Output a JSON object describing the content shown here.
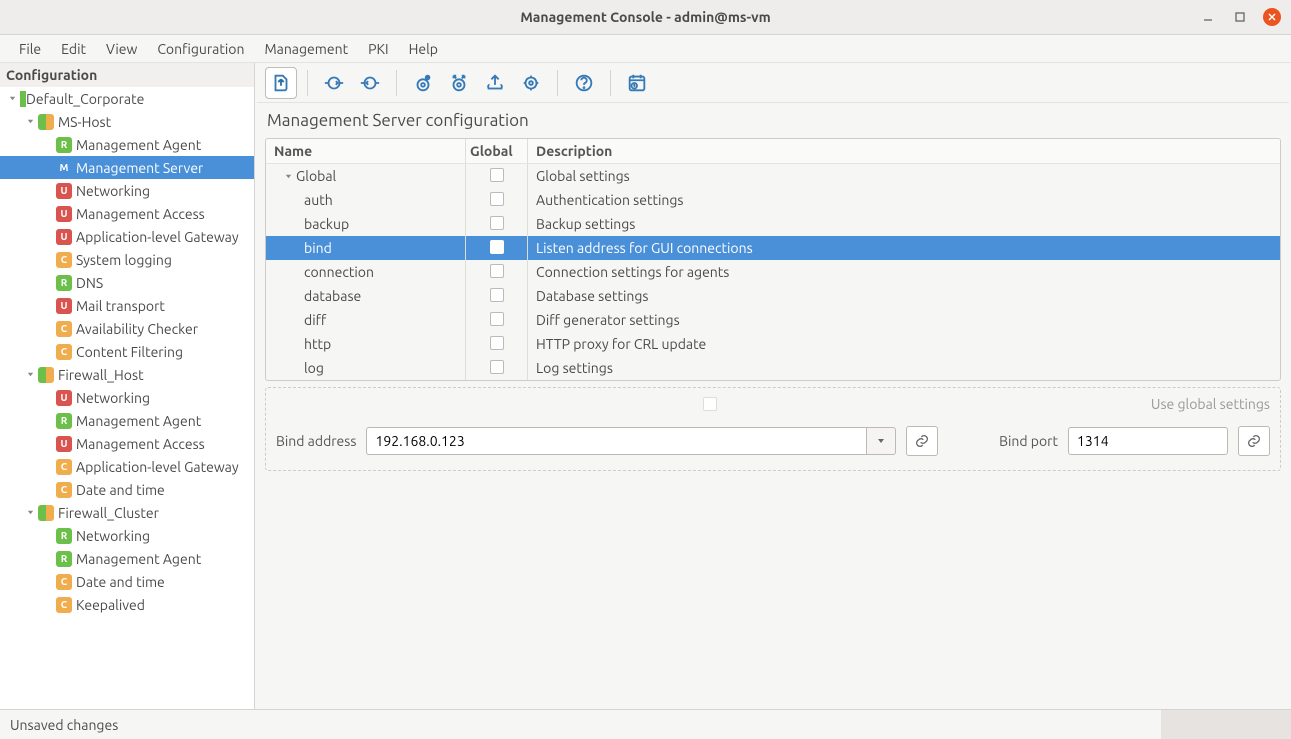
{
  "window": {
    "title": "Management Console - admin@ms-vm"
  },
  "menus": [
    "File",
    "Edit",
    "View",
    "Configuration",
    "Management",
    "PKI",
    "Help"
  ],
  "sidebar": {
    "title": "Configuration",
    "tree": [
      {
        "indent": 0,
        "exp": "down",
        "badge": "site",
        "label": "Default_Corporate"
      },
      {
        "indent": 1,
        "exp": "down",
        "badge": "host",
        "label": "MS-Host"
      },
      {
        "indent": 2,
        "exp": "",
        "badge": "R",
        "label": "Management Agent"
      },
      {
        "indent": 2,
        "exp": "",
        "badge": "M",
        "label": "Management Server",
        "selected": true
      },
      {
        "indent": 2,
        "exp": "",
        "badge": "U",
        "label": "Networking"
      },
      {
        "indent": 2,
        "exp": "",
        "badge": "U",
        "label": "Management Access"
      },
      {
        "indent": 2,
        "exp": "",
        "badge": "U",
        "label": "Application-level Gateway"
      },
      {
        "indent": 2,
        "exp": "",
        "badge": "C",
        "label": "System logging"
      },
      {
        "indent": 2,
        "exp": "",
        "badge": "R",
        "label": "DNS"
      },
      {
        "indent": 2,
        "exp": "",
        "badge": "U",
        "label": "Mail transport"
      },
      {
        "indent": 2,
        "exp": "",
        "badge": "C",
        "label": "Availability Checker"
      },
      {
        "indent": 2,
        "exp": "",
        "badge": "C",
        "label": "Content Filtering"
      },
      {
        "indent": 1,
        "exp": "down",
        "badge": "host",
        "label": "Firewall_Host"
      },
      {
        "indent": 2,
        "exp": "",
        "badge": "U",
        "label": "Networking"
      },
      {
        "indent": 2,
        "exp": "",
        "badge": "R",
        "label": "Management Agent"
      },
      {
        "indent": 2,
        "exp": "",
        "badge": "U",
        "label": "Management Access"
      },
      {
        "indent": 2,
        "exp": "",
        "badge": "C",
        "label": "Application-level Gateway"
      },
      {
        "indent": 2,
        "exp": "",
        "badge": "C",
        "label": "Date and time"
      },
      {
        "indent": 1,
        "exp": "down",
        "badge": "host",
        "label": "Firewall_Cluster"
      },
      {
        "indent": 2,
        "exp": "",
        "badge": "R",
        "label": "Networking"
      },
      {
        "indent": 2,
        "exp": "",
        "badge": "R",
        "label": "Management Agent"
      },
      {
        "indent": 2,
        "exp": "",
        "badge": "C",
        "label": "Date and time"
      },
      {
        "indent": 2,
        "exp": "",
        "badge": "C",
        "label": "Keepalived"
      }
    ]
  },
  "page": {
    "title": "Management Server configuration",
    "columns": {
      "name": "Name",
      "global": "Global",
      "desc": "Description"
    },
    "rows": [
      {
        "indent": 1,
        "exp": "down",
        "name": "Global",
        "global": false,
        "desc": "Global settings",
        "selected": false
      },
      {
        "indent": 2,
        "exp": "",
        "name": "auth",
        "global": false,
        "desc": "Authentication settings"
      },
      {
        "indent": 2,
        "exp": "",
        "name": "backup",
        "global": false,
        "desc": "Backup settings"
      },
      {
        "indent": 2,
        "exp": "",
        "name": "bind",
        "global": false,
        "desc": "Listen address for GUI connections",
        "selected": true
      },
      {
        "indent": 2,
        "exp": "",
        "name": "connection",
        "global": false,
        "desc": "Connection settings for agents"
      },
      {
        "indent": 2,
        "exp": "",
        "name": "database",
        "global": false,
        "desc": "Database settings"
      },
      {
        "indent": 2,
        "exp": "",
        "name": "diff",
        "global": false,
        "desc": "Diff generator settings"
      },
      {
        "indent": 2,
        "exp": "",
        "name": "http",
        "global": false,
        "desc": "HTTP proxy for CRL update"
      },
      {
        "indent": 2,
        "exp": "",
        "name": "log",
        "global": false,
        "desc": "Log settings"
      }
    ],
    "use_global_label": "Use global settings",
    "bind_address_label": "Bind address",
    "bind_address_value": "192.168.0.123",
    "bind_port_label": "Bind port",
    "bind_port_value": "1314"
  },
  "status": "Unsaved changes"
}
